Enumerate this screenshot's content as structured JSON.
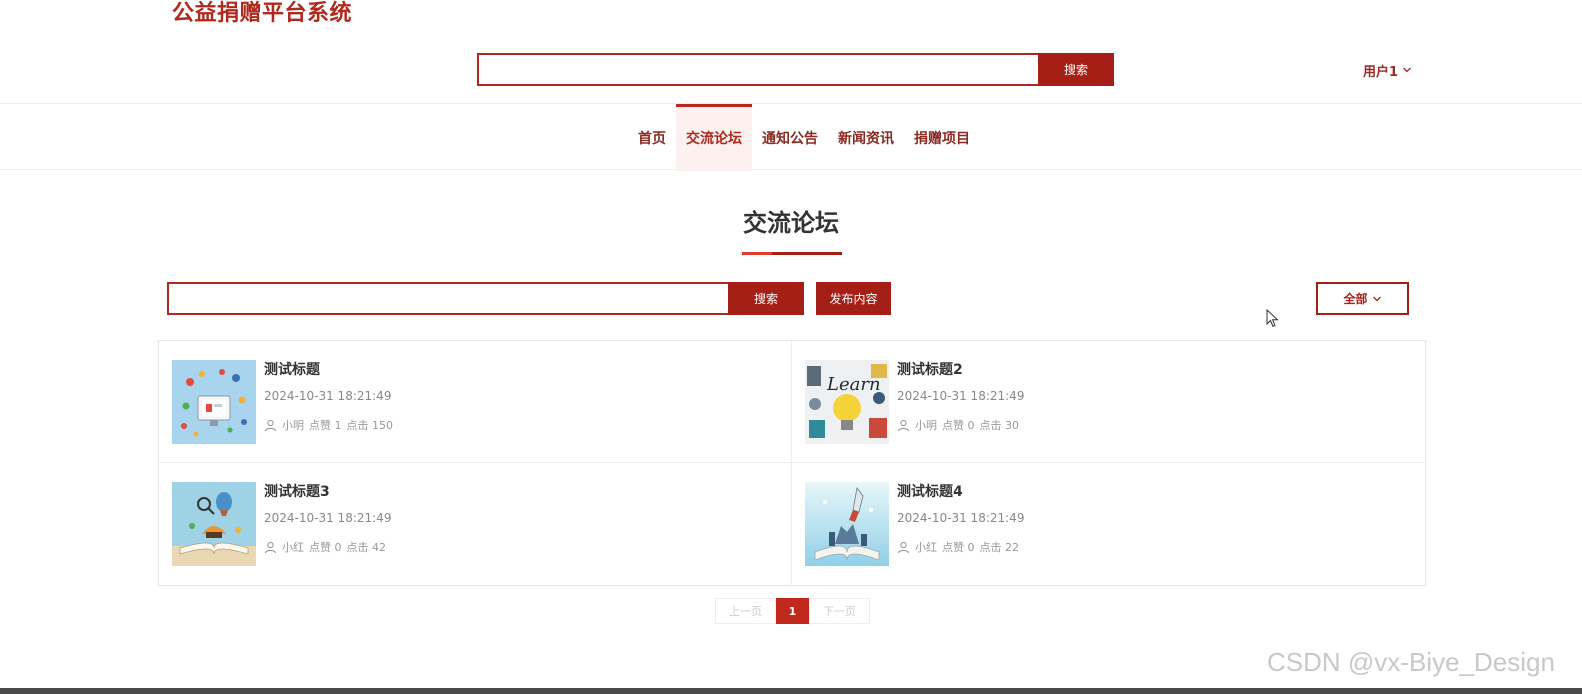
{
  "header": {
    "site_title": "公益捐赠平台系统",
    "search": {
      "placeholder": "",
      "button_label": "搜索"
    },
    "user_label": "用户1"
  },
  "nav": {
    "items": [
      {
        "label": "首页",
        "active": false
      },
      {
        "label": "交流论坛",
        "active": true
      },
      {
        "label": "通知公告",
        "active": false
      },
      {
        "label": "新闻资讯",
        "active": false
      },
      {
        "label": "捐赠项目",
        "active": false
      }
    ]
  },
  "main": {
    "title": "交流论坛",
    "search": {
      "placeholder": "",
      "button_label": "搜索"
    },
    "publish_label": "发布内容",
    "filter_label": "全部"
  },
  "posts": [
    {
      "title": "测试标题",
      "date": "2024-10-31 18:21:49",
      "author": "小明",
      "likes": "点赞 1",
      "clicks": "点击 150",
      "thumb_icon": "social-media-icons-image"
    },
    {
      "title": "测试标题2",
      "date": "2024-10-31 18:21:49",
      "author": "小明",
      "likes": "点赞 0",
      "clicks": "点击 30",
      "thumb_icon": "learn-lightbulb-image"
    },
    {
      "title": "测试标题3",
      "date": "2024-10-31 18:21:49",
      "author": "小红",
      "likes": "点赞 0",
      "clicks": "点击 42",
      "thumb_icon": "open-book-balloon-image"
    },
    {
      "title": "测试标题4",
      "date": "2024-10-31 18:21:49",
      "author": "小红",
      "likes": "点赞 0",
      "clicks": "点击 22",
      "thumb_icon": "book-rocket-image"
    }
  ],
  "pagination": {
    "prev_label": "上一页",
    "current": "1",
    "next_label": "下一页"
  },
  "watermark": "CSDN @vx-Biye_Design",
  "colors": {
    "brand": "#a61f16",
    "brand_bright": "#c0281c",
    "nav_active_bg": "#fdf1f0"
  }
}
